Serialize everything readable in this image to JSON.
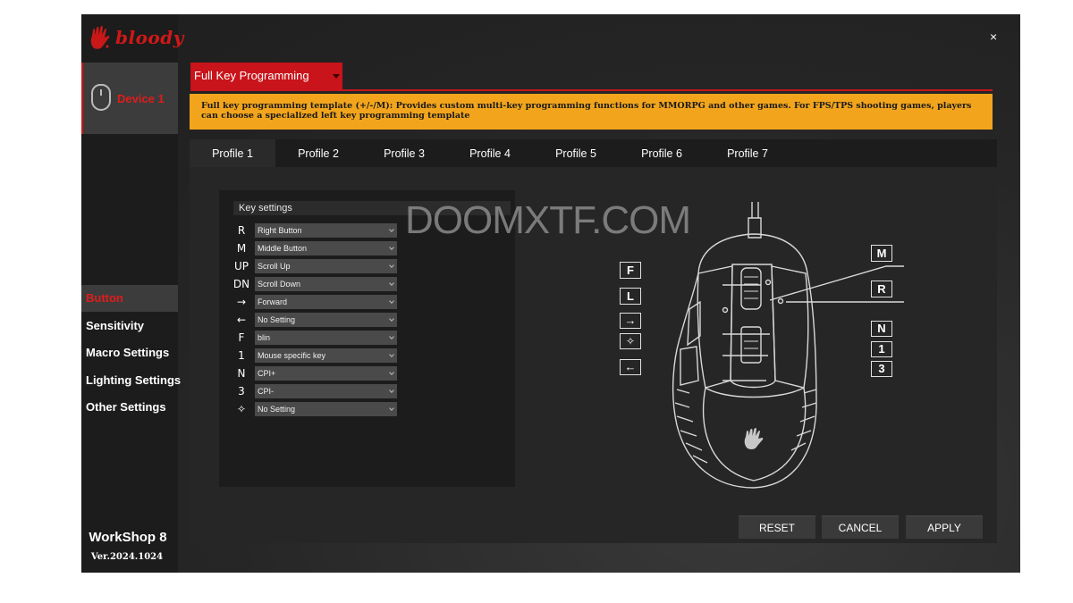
{
  "app": {
    "brand": "bloody",
    "device_label": "Device 1",
    "close_glyph": "×",
    "workshop": "WorkShop 8",
    "version": "Ver.2024.1024"
  },
  "nav": [
    "Button",
    "Sensitivity",
    "Macro Settings",
    "Lighting Settings",
    "Other Settings"
  ],
  "mode": {
    "selected": "Full Key Programming"
  },
  "info": "Full key programming template (+/-/M): Provides custom multi-key programming functions for MMORPG and other games.  For FPS/TPS shooting games, players can choose a specialized left key programming template",
  "tabs": [
    "Profile 1",
    "Profile 2",
    "Profile 3",
    "Profile 4",
    "Profile 5",
    "Profile 6",
    "Profile 7"
  ],
  "key_settings": {
    "title": "Key settings",
    "rows": [
      {
        "key": "R",
        "value": "Right Button"
      },
      {
        "key": "M",
        "value": "Middle Button"
      },
      {
        "key": "UP",
        "value": "Scroll Up"
      },
      {
        "key": "DN",
        "value": "Scroll Down"
      },
      {
        "key": "→",
        "value": "Forward"
      },
      {
        "key": "←",
        "value": "No Setting"
      },
      {
        "key": "F",
        "value": "blin"
      },
      {
        "key": "1",
        "value": "Mouse specific key"
      },
      {
        "key": "N",
        "value": "CPI+"
      },
      {
        "key": "3",
        "value": "CPI-"
      },
      {
        "key": "✧",
        "value": "No Setting"
      }
    ]
  },
  "watermark": "DOOMXTF.COM",
  "diagram": {
    "labels": {
      "F": "F",
      "L": "L",
      "fwd": "→",
      "star": "✧",
      "back": "←",
      "M": "M",
      "R": "R",
      "N": "N",
      "one": "1",
      "three": "3"
    }
  },
  "buttons": {
    "reset": "RESET",
    "cancel": "CANCEL",
    "apply": "APPLY"
  },
  "colors": {
    "accent_red": "#c8141a",
    "info_bar": "#f2a51c"
  }
}
